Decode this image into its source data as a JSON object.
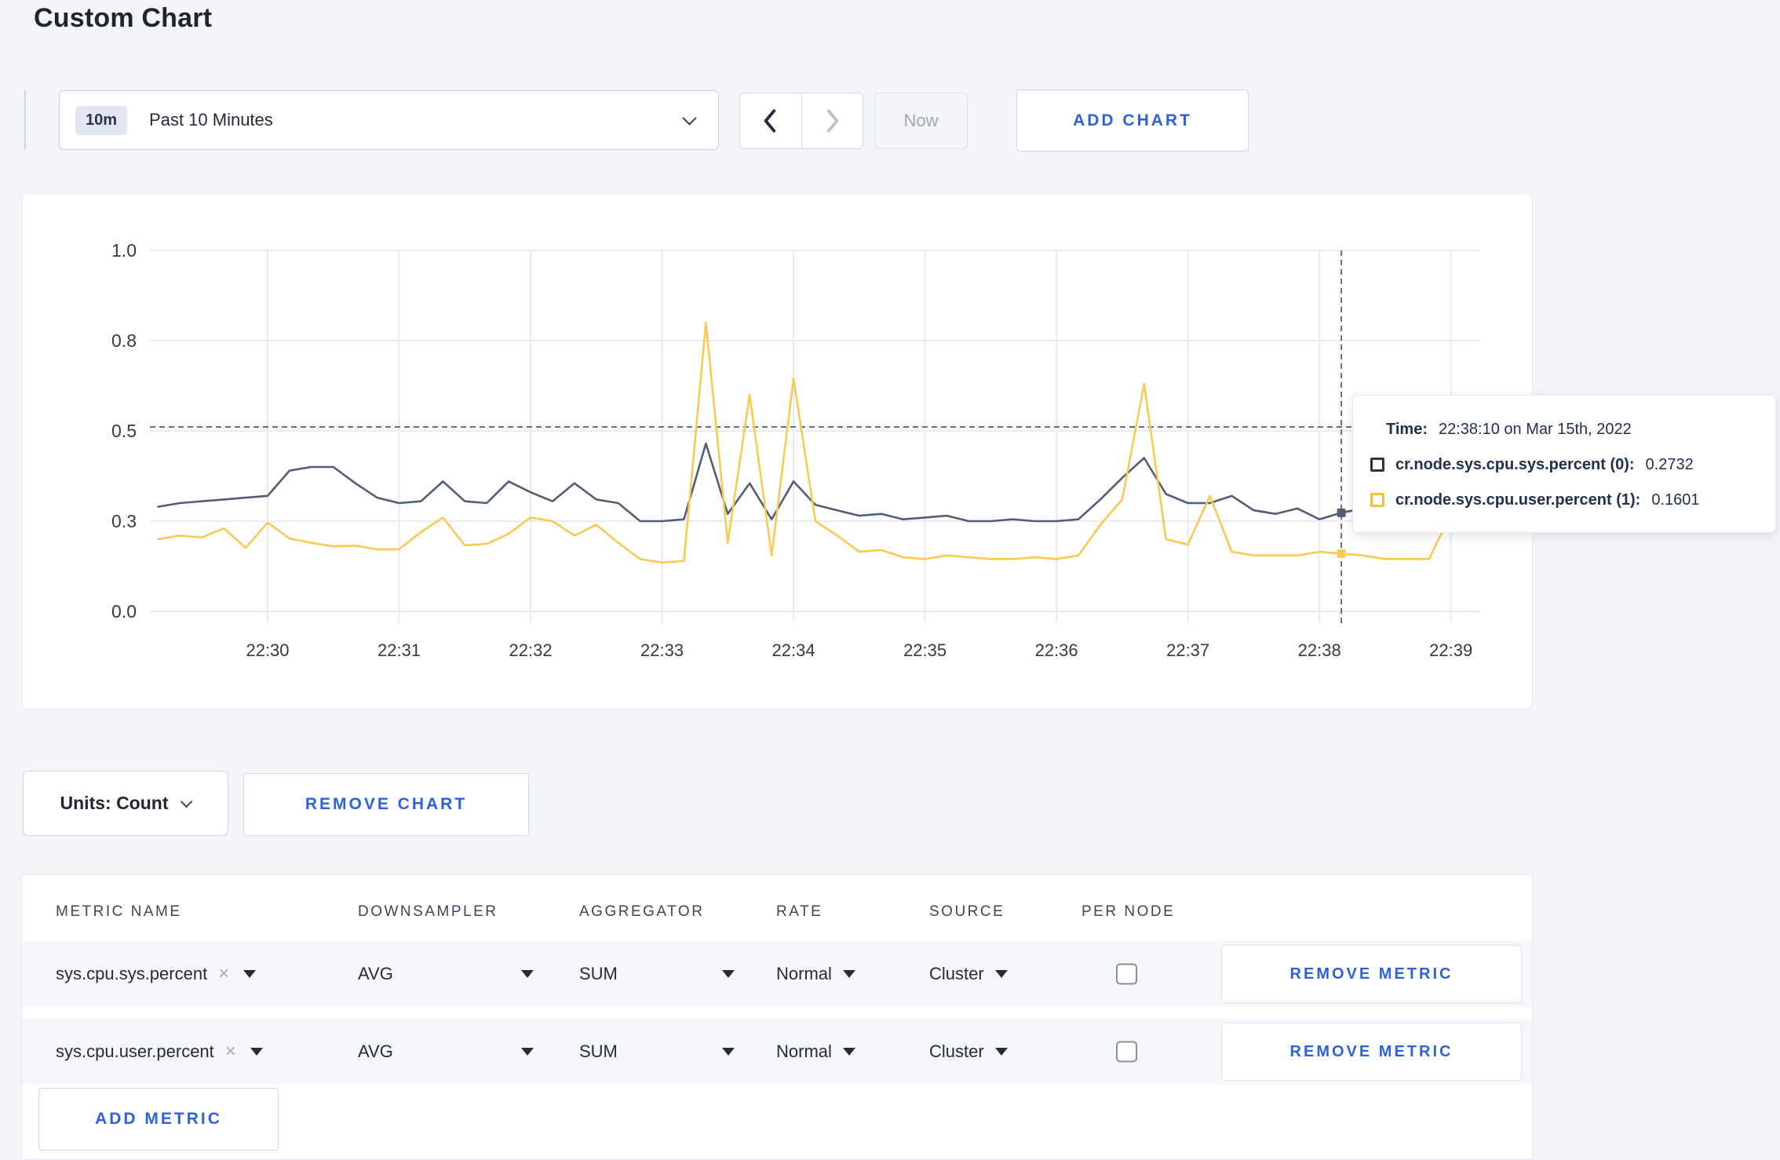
{
  "page": {
    "title": "Custom Chart"
  },
  "toolbar": {
    "time_window_badge": "10m",
    "time_window_label": "Past 10 Minutes",
    "now_label": "Now",
    "add_chart_label": "ADD CHART"
  },
  "chart_footer": {
    "units_label": "Units: Count",
    "remove_chart_label": "REMOVE CHART"
  },
  "tooltip": {
    "time_label": "Time:",
    "time_value": "22:38:10 on Mar 15th, 2022",
    "rows": [
      {
        "label": "cr.node.sys.cpu.sys.percent (0):",
        "value": "0.2732",
        "color": "#26334f"
      },
      {
        "label": "cr.node.sys.cpu.user.percent (1):",
        "value": "0.1601",
        "color": "#f2c137"
      }
    ]
  },
  "chart_data": {
    "type": "line",
    "title": "",
    "xlabel": "",
    "ylabel": "",
    "ylim": [
      0,
      1
    ],
    "grid": true,
    "legend_position": "tooltip-only",
    "x_start_time": "22:29:10",
    "x_end_time": "22:39:10",
    "sample_interval_seconds": 10,
    "x_tick_labels": [
      "22:30",
      "22:31",
      "22:32",
      "22:33",
      "22:34",
      "22:35",
      "22:36",
      "22:37",
      "22:38",
      "22:39"
    ],
    "y_tick_labels": [
      "0.0",
      "0.3",
      "0.5",
      "0.8",
      "1.0"
    ],
    "y_tick_values": [
      0,
      0.25,
      0.5,
      0.75,
      1
    ],
    "series": [
      {
        "name": "cr.node.sys.cpu.sys.percent (0)",
        "color": "#525d78",
        "values": [
          0.29,
          0.3,
          0.305,
          0.31,
          0.315,
          0.32,
          0.39,
          0.4,
          0.4,
          0.355,
          0.315,
          0.3,
          0.305,
          0.36,
          0.305,
          0.3,
          0.36,
          0.33,
          0.305,
          0.355,
          0.31,
          0.3,
          0.25,
          0.25,
          0.255,
          0.465,
          0.27,
          0.355,
          0.255,
          0.36,
          0.295,
          0.28,
          0.265,
          0.27,
          0.255,
          0.26,
          0.265,
          0.25,
          0.25,
          0.255,
          0.25,
          0.25,
          0.255,
          0.31,
          0.37,
          0.425,
          0.325,
          0.3,
          0.3,
          0.32,
          0.28,
          0.27,
          0.285,
          0.255,
          0.2732,
          0.285,
          0.255,
          0.28,
          0.3,
          0.295,
          0.28
        ]
      },
      {
        "name": "cr.node.sys.cpu.user.percent (1)",
        "color": "#f8ca54",
        "values": [
          0.2,
          0.21,
          0.205,
          0.23,
          0.176,
          0.246,
          0.202,
          0.19,
          0.18,
          0.182,
          0.172,
          0.172,
          0.22,
          0.26,
          0.183,
          0.187,
          0.215,
          0.26,
          0.25,
          0.21,
          0.24,
          0.19,
          0.145,
          0.135,
          0.14,
          0.8,
          0.19,
          0.6,
          0.155,
          0.645,
          0.25,
          0.21,
          0.165,
          0.17,
          0.15,
          0.145,
          0.155,
          0.15,
          0.145,
          0.145,
          0.15,
          0.145,
          0.155,
          0.24,
          0.31,
          0.63,
          0.2,
          0.185,
          0.32,
          0.165,
          0.155,
          0.155,
          0.155,
          0.165,
          0.1601,
          0.155,
          0.145,
          0.145,
          0.145,
          0.27,
          0.22
        ]
      }
    ],
    "hover": {
      "index": 54,
      "time": "22:38:10",
      "mouse_value": 0.511,
      "values": [
        0.2732,
        0.1601
      ]
    }
  },
  "metrics_table": {
    "headers": [
      "METRIC NAME",
      "DOWNSAMPLER",
      "AGGREGATOR",
      "RATE",
      "SOURCE",
      "PER NODE"
    ],
    "rows": [
      {
        "metric": "sys.cpu.sys.percent",
        "downsampler": "AVG",
        "aggregator": "SUM",
        "rate": "Normal",
        "source": "Cluster",
        "per_node_checked": false,
        "remove_label": "REMOVE METRIC"
      },
      {
        "metric": "sys.cpu.user.percent",
        "downsampler": "AVG",
        "aggregator": "SUM",
        "rate": "Normal",
        "source": "Cluster",
        "per_node_checked": false,
        "remove_label": "REMOVE METRIC"
      }
    ],
    "add_metric_label": "ADD METRIC"
  },
  "icons": {
    "clear": "×"
  },
  "colors": {
    "accent_blue": "#2e62d9",
    "page_bg": "#f4f5f9",
    "gridline": "#e9ebf0",
    "crosshair": "#5d7084"
  }
}
